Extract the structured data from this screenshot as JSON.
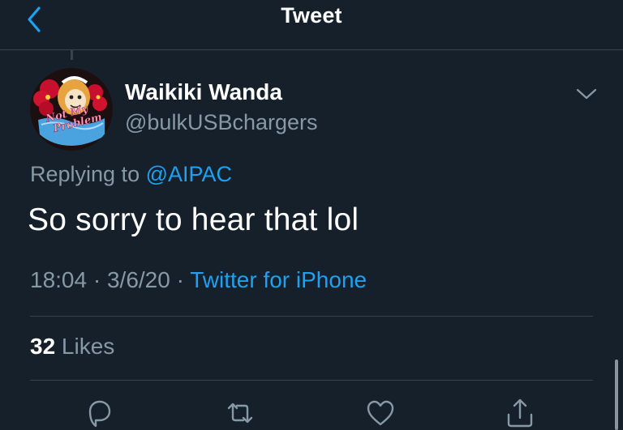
{
  "nav": {
    "title": "Tweet"
  },
  "tweet": {
    "display_name": "Waikiki Wanda",
    "handle": "@bulkUSBchargers",
    "replying_prefix": "Replying to ",
    "replying_to": "@AIPAC",
    "text": "So sorry to hear that lol",
    "time": "18:04",
    "separator_1": " · ",
    "date": "3/6/20",
    "separator_2": " · ",
    "source": "Twitter for iPhone",
    "likes_count": "32",
    "likes_label": " Likes",
    "avatar_logo_text": "Not My Problem"
  },
  "icons": {
    "back": "chevron-left-icon",
    "more": "chevron-down-icon",
    "reply": "reply-icon",
    "retweet": "retweet-icon",
    "like": "heart-icon",
    "share": "share-icon"
  },
  "colors": {
    "background": "#15202b",
    "accent": "#1da1f2",
    "secondary_text": "#8899a6",
    "divider": "#38444d"
  }
}
